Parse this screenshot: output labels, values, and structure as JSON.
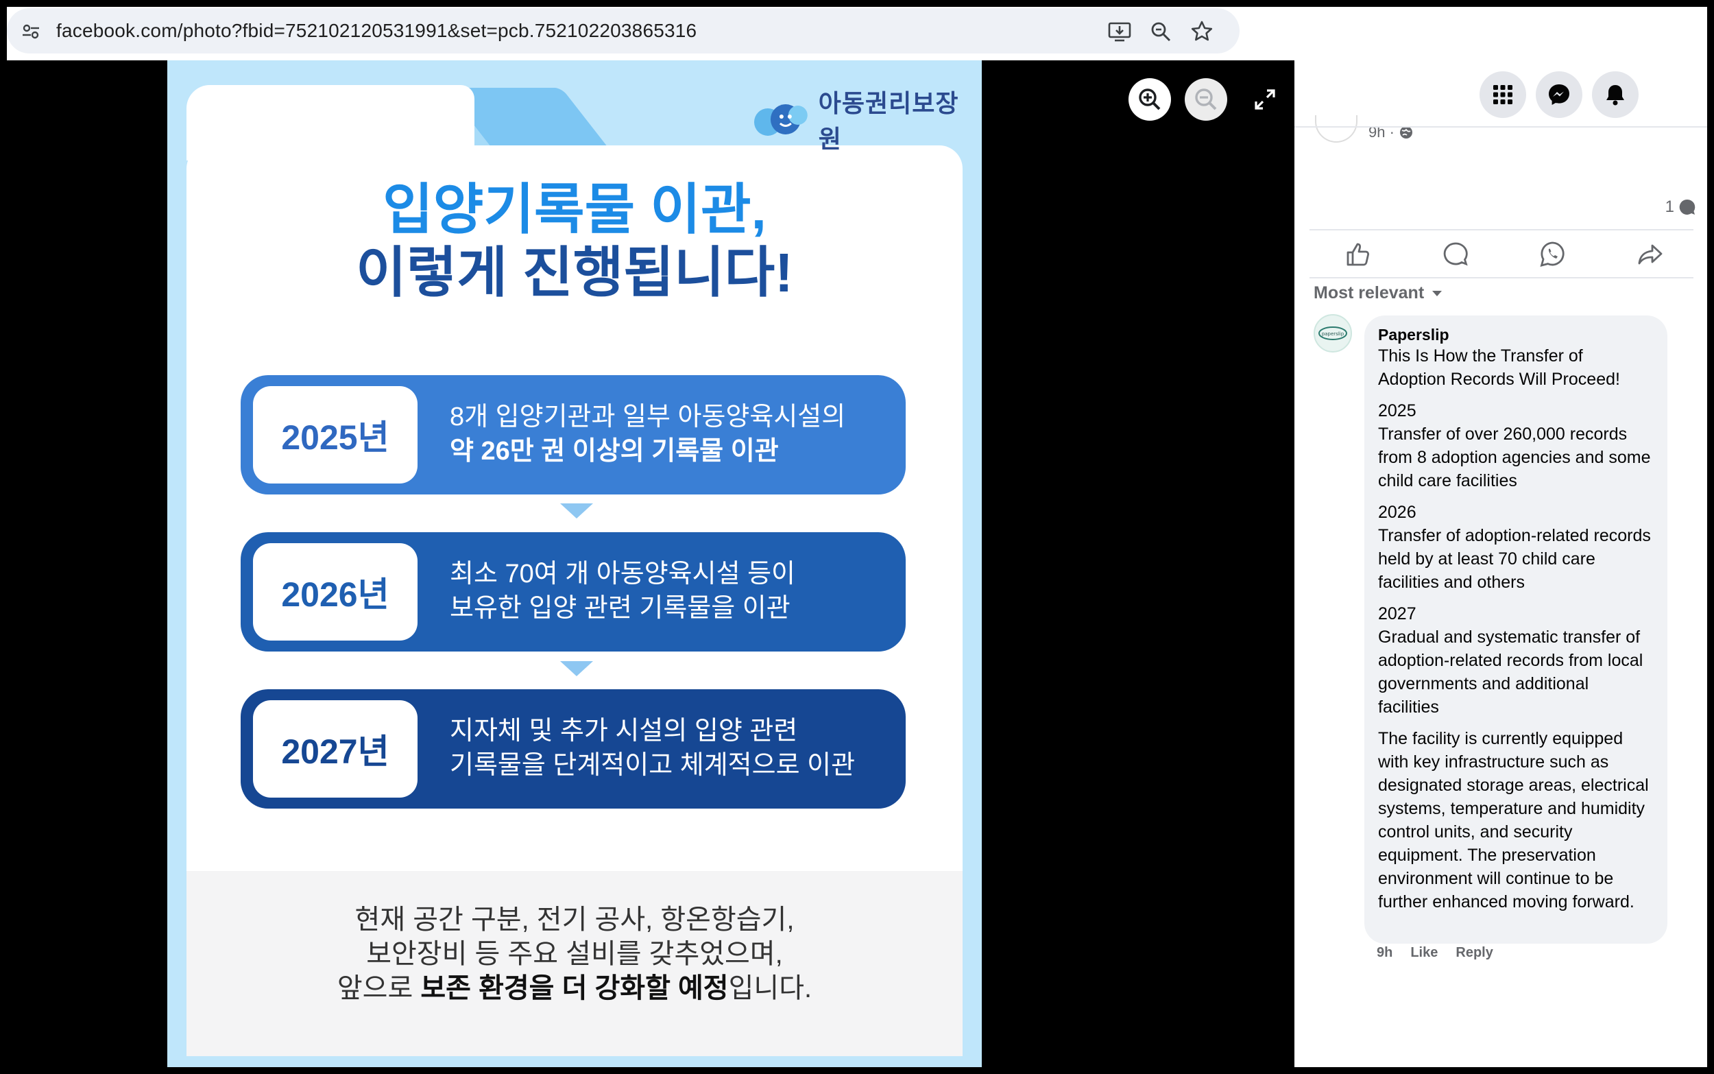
{
  "browser": {
    "url": "facebook.com/photo?fbid=752102120531991&set=pcb.752102203865316",
    "actions": [
      "install-app-icon",
      "zoom-icon",
      "bookmark-star-icon"
    ]
  },
  "photo": {
    "brand": "아동권리보장원",
    "headline_line1": "입양기록물 이관,",
    "headline_line2": "이렇게 진행됩니다!",
    "steps": [
      {
        "year": "2025년",
        "line1": "8개 입양기관과 일부 아동양육시설의",
        "line2": "약 26만 권 이상의 기록물 이관",
        "color": "#3a7fd5",
        "year_color": "#2f68c0"
      },
      {
        "year": "2026년",
        "line1": "최소 70여 개 아동양육시설 등이",
        "line2": "보유한 입양 관련 기록물을 이관",
        "color": "#1f5fb1",
        "year_color": "#1f5fb1"
      },
      {
        "year": "2027년",
        "line1": "지자체 및 추가 시설의 입양 관련",
        "line2": "기록물을 단계적이고 체계적으로 이관",
        "color": "#164793",
        "year_color": "#164793"
      }
    ],
    "bottom_line1": "현재 공간 구분, 전기 공사, 항온항습기,",
    "bottom_line2": "보안장비 등 주요 설비를 갖추었으며,",
    "bottom_line3_pre": "앞으로 ",
    "bottom_line3_bold": "보존 환경을 더 강화할 예정",
    "bottom_line3_post": "입니다."
  },
  "viewer_controls": [
    "zoom-in-icon",
    "zoom-out-icon",
    "fullscreen-icon"
  ],
  "sidebar": {
    "post_time": "9h ·",
    "comment_count": "1",
    "sort_label": "Most relevant",
    "comment": {
      "author": "Paperslip",
      "avatar_text": "paperslip",
      "paragraphs": [
        "This Is How the Transfer of Adoption Records Will Proceed!",
        "2025\nTransfer of over 260,000 records from 8 adoption agencies and some child care facilities",
        "2026\nTransfer of adoption-related records held by at least 70 child care facilities and others",
        "2027\nGradual and systematic transfer of adoption-related records from local governments and additional facilities",
        "The facility is currently equipped with key infrastructure such as designated storage areas, electrical systems, temperature and humidity control units, and security equipment. The preservation environment will continue to be further enhanced moving forward."
      ],
      "time": "9h",
      "like_label": "Like",
      "reply_label": "Reply"
    }
  }
}
